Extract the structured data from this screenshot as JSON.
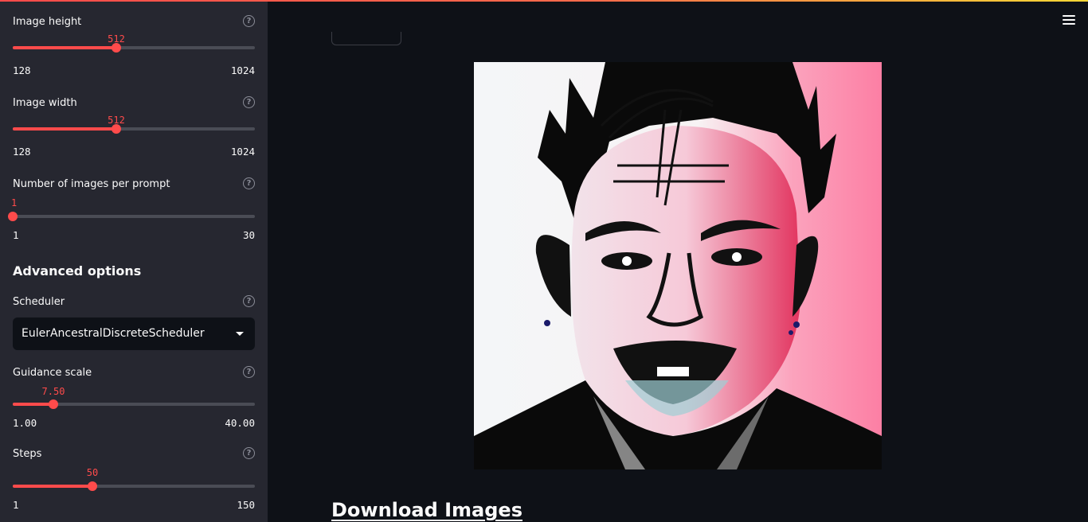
{
  "sidebar": {
    "sliders": [
      {
        "label": "Image height",
        "value": "512",
        "min": "128",
        "max": "1024",
        "fraction": 0.4286
      },
      {
        "label": "Image width",
        "value": "512",
        "min": "128",
        "max": "1024",
        "fraction": 0.4286
      },
      {
        "label": "Number of images per prompt",
        "value": "1",
        "min": "1",
        "max": "30",
        "fraction": 0.0
      }
    ],
    "advanced_title": "Advanced options",
    "scheduler": {
      "label": "Scheduler",
      "selected": "EulerAncestralDiscreteScheduler"
    },
    "guidance": {
      "label": "Guidance scale",
      "value": "7.50",
      "min": "1.00",
      "max": "40.00",
      "fraction": 0.1667
    },
    "steps": {
      "label": "Steps",
      "value": "50",
      "min": "1",
      "max": "150",
      "fraction": 0.3289
    },
    "help_glyph": "?"
  },
  "main": {
    "download_link": "Download Images",
    "menu_icon": "hamburger-menu-icon",
    "image": "generated-portrait-image"
  },
  "colors": {
    "accent": "#ff4b4b",
    "sidebar_bg": "#262730",
    "main_bg": "#0e1117",
    "track": "#4a4c55"
  }
}
